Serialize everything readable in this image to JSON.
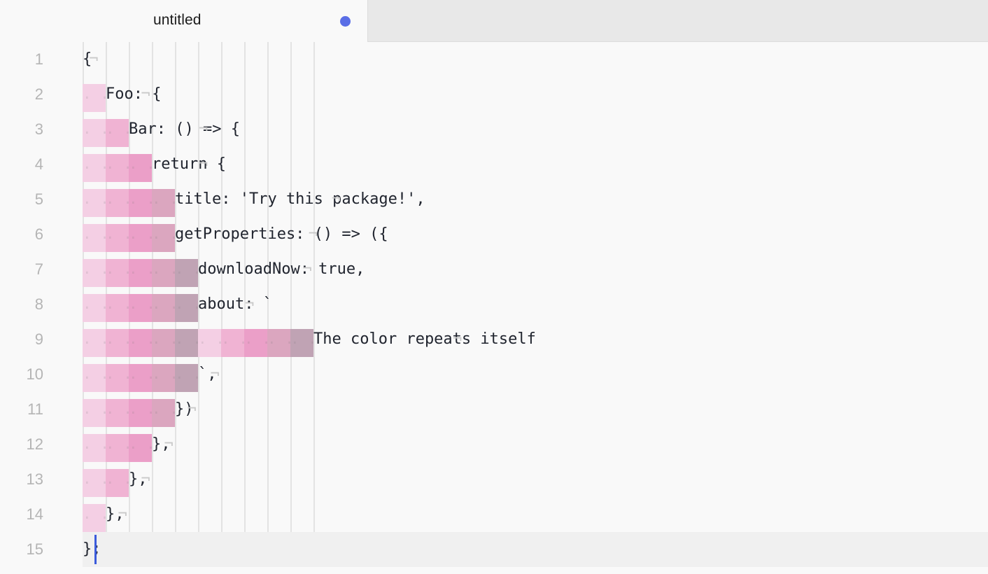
{
  "window": {
    "background_color": "#f9f9f9",
    "tabbar_background_color": "#e8e8e8"
  },
  "tabbar": {
    "active_tab": {
      "title": "untitled",
      "dirty_indicator": "unsaved-dot",
      "dirty_color": "#5a6ee6"
    }
  },
  "editor": {
    "indent_size": 4,
    "render_whitespace_char": "·",
    "eol_marker": "¬",
    "cursor": {
      "line": 15,
      "column": 3,
      "color": "#3b5bdb"
    },
    "current_line": 15,
    "current_line_highlight_color": "#f0f0f0",
    "gutter_color": "#b5b5b5",
    "text_color": "#20242e",
    "indent_guide_colors": [
      "#f4cfe4",
      "#f0b3d3",
      "#eb9fc8",
      "#dba6bf",
      "#c0a3b4"
    ],
    "lines": [
      {
        "n": 1,
        "indent": 0,
        "text": "{",
        "eol": true
      },
      {
        "n": 2,
        "indent": 1,
        "text": "Foo: {",
        "eol": true
      },
      {
        "n": 3,
        "indent": 2,
        "text": "Bar: () => {",
        "eol": true
      },
      {
        "n": 4,
        "indent": 3,
        "text": "return {",
        "eol": true
      },
      {
        "n": 5,
        "indent": 4,
        "text": "title: 'Try this package!',",
        "eol": true
      },
      {
        "n": 6,
        "indent": 4,
        "text": "getProperties: () => ({",
        "eol": true
      },
      {
        "n": 7,
        "indent": 5,
        "text": "downloadNow: true,",
        "eol": true
      },
      {
        "n": 8,
        "indent": 5,
        "text": "about: `",
        "eol": true
      },
      {
        "n": 9,
        "indent": 10,
        "text": "The color repeats itself",
        "eol": true
      },
      {
        "n": 10,
        "indent": 5,
        "text": "`,",
        "eol": true
      },
      {
        "n": 11,
        "indent": 4,
        "text": "})",
        "eol": true
      },
      {
        "n": 12,
        "indent": 3,
        "text": "},",
        "eol": true
      },
      {
        "n": 13,
        "indent": 2,
        "text": "},",
        "eol": true
      },
      {
        "n": 14,
        "indent": 1,
        "text": "},",
        "eol": true
      },
      {
        "n": 15,
        "indent": 0,
        "text": "};",
        "eol": false
      }
    ]
  }
}
